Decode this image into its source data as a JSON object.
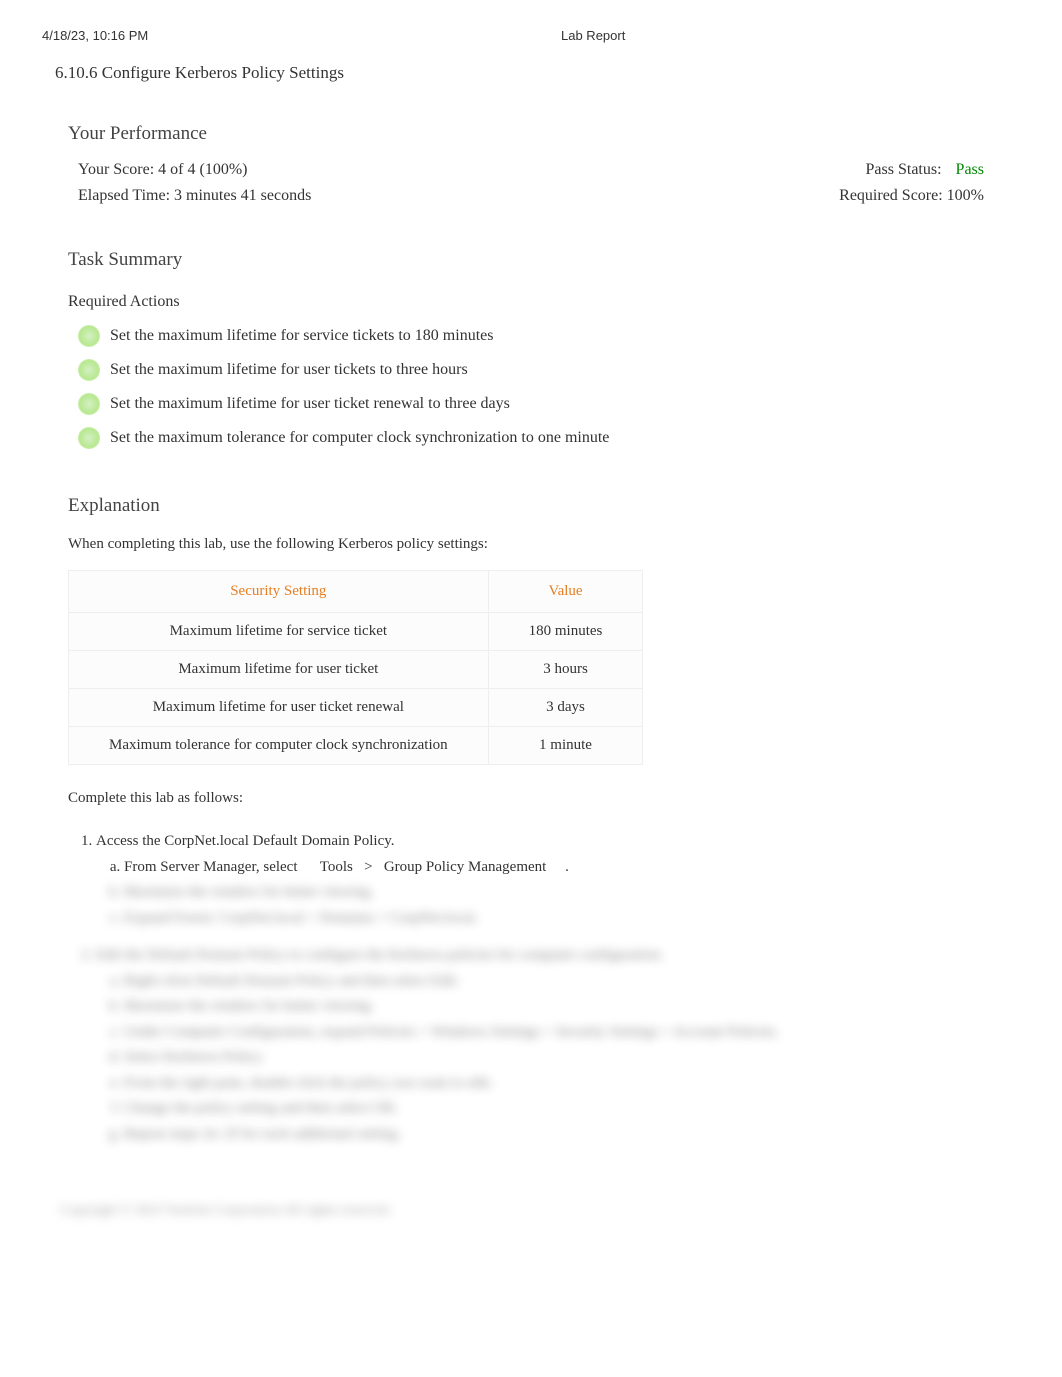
{
  "header": {
    "datetime": "4/18/23, 10:16 PM",
    "title": "Lab Report"
  },
  "page_title": "6.10.6 Configure Kerberos Policy Settings",
  "performance": {
    "heading": "Your Performance",
    "score_label": "Your Score: 4 of 4 (100%)",
    "pass_status_label": "Pass Status:",
    "pass_status_value": "Pass",
    "elapsed_label": "Elapsed Time: 3 minutes 41 seconds",
    "required_label": "Required Score: 100%"
  },
  "task_summary": {
    "heading": "Task Summary",
    "subheading": "Required Actions",
    "actions": [
      "Set the maximum lifetime for service tickets to 180 minutes",
      "Set the maximum lifetime for user tickets to three hours",
      "Set the maximum lifetime for user ticket renewal to three days",
      "Set the maximum tolerance for computer clock synchronization to one minute"
    ]
  },
  "explanation": {
    "heading": "Explanation",
    "intro": "When completing this lab, use the following Kerberos policy settings:",
    "table": {
      "headers": [
        "Security Setting",
        "Value"
      ],
      "rows": [
        [
          "Maximum lifetime for service ticket",
          "180 minutes"
        ],
        [
          "Maximum lifetime for user ticket",
          "3 hours"
        ],
        [
          "Maximum lifetime for user ticket renewal",
          "3 days"
        ],
        [
          "Maximum tolerance for computer clock synchronization",
          "1 minute"
        ]
      ]
    },
    "complete_text": "Complete this lab as follows:",
    "steps": {
      "step1": "Access the CorpNet.local Default Domain Policy.",
      "step1a_prefix": "From Server Manager, select",
      "step1a_tools": "Tools",
      "step1a_sep": ">",
      "step1a_gpm": "Group Policy Management",
      "step1a_suffix": ".",
      "blurred_b": "Maximize the window for better viewing.",
      "blurred_c": "Expand Forest: CorpNet.local > Domains > CorpNet.local.",
      "step2": "Edit the Default Domain Policy to configure the Kerberos policies for computer configuration.",
      "blurred_2a": "Right-click Default Domain Policy and then select Edit.",
      "blurred_2b": "Maximize the window for better viewing.",
      "blurred_2c": "Under Computer Configuration, expand Policies > Windows Settings > Security Settings > Account Policies.",
      "blurred_2d": "Select Kerberos Policy.",
      "blurred_2e": "From the right pane, double-click the policy you want to edit.",
      "blurred_2f": "Change the policy setting and then select OK.",
      "blurred_2g": "Repeat steps 2e–2f for each additional setting."
    }
  },
  "copyright": "Copyright © 2023 TestOut Corporation All rights reserved."
}
